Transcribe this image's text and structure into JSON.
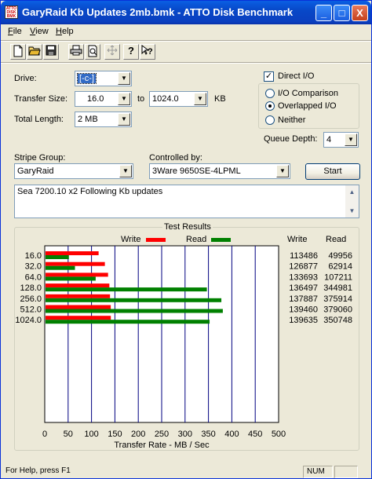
{
  "window": {
    "title": "GaryRaid Kb Updates  2mb.bmk - ATTO Disk Benchmark",
    "minimize": "_",
    "maximize": "□",
    "close": "X",
    "icon_text": [
      "ATTO",
      "DISK",
      "BMK"
    ]
  },
  "menu": [
    {
      "label": "File",
      "underline": "F"
    },
    {
      "label": "View",
      "underline": "V"
    },
    {
      "label": "Help",
      "underline": "H"
    }
  ],
  "toolbar": [
    "new-file-icon",
    "open-folder-icon",
    "save-icon",
    "print-icon",
    "print-preview-icon",
    "move-icon",
    "help-icon",
    "context-help-icon"
  ],
  "form": {
    "drive_label": "Drive:",
    "drive_value": "[-c-]",
    "transfer_size_label": "Transfer Size:",
    "transfer_from": "16.0",
    "to_label": "to",
    "transfer_to": "1024.0",
    "kb_label": "KB",
    "total_length_label": "Total Length:",
    "total_length": "2 MB",
    "direct_io_label": "Direct I/O",
    "direct_io_checked": true,
    "io_comparison_label": "I/O Comparison",
    "overlapped_io_label": "Overlapped I/O",
    "neither_label": "Neither",
    "selected_mode": "overlapped",
    "queue_depth_label": "Queue Depth:",
    "queue_depth": "4",
    "stripe_group_label": "Stripe Group:",
    "stripe_group": "GaryRaid",
    "controlled_by_label": "Controlled by:",
    "controlled_by": "3Ware 9650SE-4LPML",
    "start_label": "Start",
    "notes": "Sea 7200.10 x2 Following Kb updates"
  },
  "results": {
    "title": "Test Results",
    "write_legend": "Write",
    "read_legend": "Read",
    "write_header": "Write",
    "read_header": "Read",
    "write_color": "#ff0000",
    "read_color": "#008000"
  },
  "chart_data": {
    "type": "bar",
    "orientation": "horizontal",
    "categories": [
      "16.0",
      "32.0",
      "64.0",
      "128.0",
      "256.0",
      "512.0",
      "1024.0"
    ],
    "series": [
      {
        "name": "Write",
        "values": [
          113486,
          126877,
          133693,
          136497,
          137887,
          139460,
          139635
        ]
      },
      {
        "name": "Read",
        "values": [
          49956,
          62914,
          107211,
          344981,
          375914,
          379060,
          350748
        ]
      }
    ],
    "xlabel": "Transfer Rate - MB / Sec",
    "xticks": [
      "0",
      "50",
      "100",
      "150",
      "200",
      "250",
      "300",
      "350",
      "400",
      "450",
      "500"
    ],
    "xlim": [
      0,
      500
    ],
    "grid": true
  },
  "status": {
    "help_text": "For Help, press F1",
    "num": "NUM"
  }
}
